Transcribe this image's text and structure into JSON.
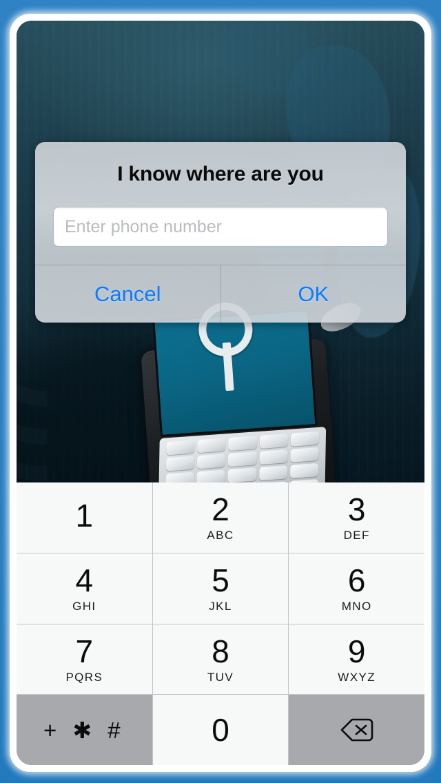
{
  "app": {
    "accent_blue": "#2a7fc0",
    "link_blue": "#0a7bff",
    "key_bg": "#f7f8f8",
    "key_gray_bg": "#a7a9ac"
  },
  "dialog": {
    "title": "I know where are you",
    "input": {
      "placeholder": "Enter phone number",
      "value": ""
    },
    "cancel_label": "Cancel",
    "ok_label": "OK"
  },
  "keypad": {
    "keys": [
      {
        "digit": "1",
        "letters": ""
      },
      {
        "digit": "2",
        "letters": "ABC"
      },
      {
        "digit": "3",
        "letters": "DEF"
      },
      {
        "digit": "4",
        "letters": "GHI"
      },
      {
        "digit": "5",
        "letters": "JKL"
      },
      {
        "digit": "6",
        "letters": "MNO"
      },
      {
        "digit": "7",
        "letters": "PQRS"
      },
      {
        "digit": "8",
        "letters": "TUV"
      },
      {
        "digit": "9",
        "letters": "WXYZ"
      }
    ],
    "symbols_label": "+ ✱ #",
    "zero_label": "0",
    "backspace_icon": "backspace-icon"
  }
}
